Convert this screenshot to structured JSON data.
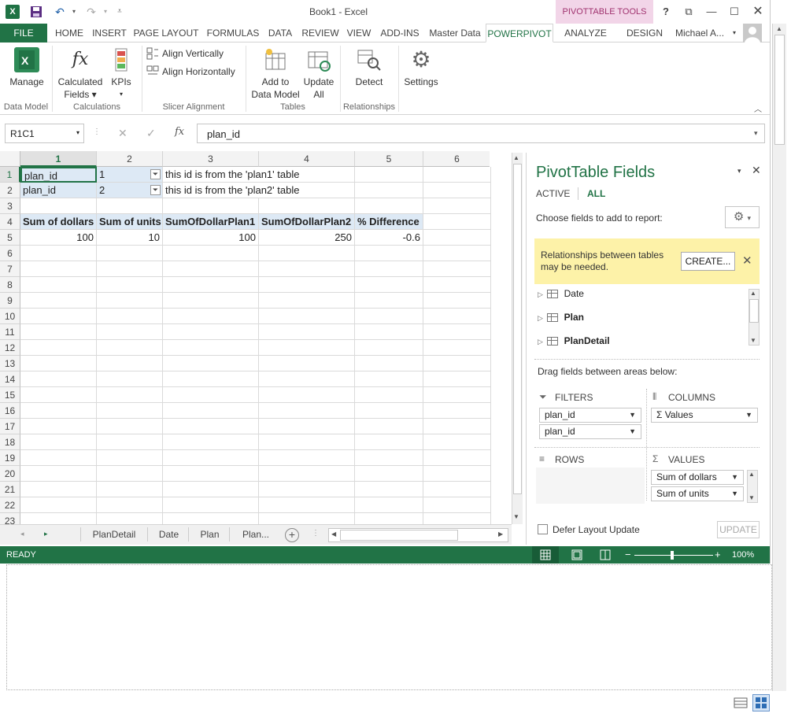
{
  "titlebar": {
    "title": "Book1 - Excel",
    "pivot_tools": "PIVOTTABLE TOOLS",
    "help": "?"
  },
  "tabs": {
    "file": "FILE",
    "items": [
      "HOME",
      "INSERT",
      "PAGE LAYOUT",
      "FORMULAS",
      "DATA",
      "REVIEW",
      "VIEW",
      "ADD-INS",
      "Master Data",
      "POWERPIVOT",
      "ANALYZE",
      "DESIGN"
    ],
    "user": "Michael A..."
  },
  "ribbon": {
    "manage": "Manage",
    "calculated_fields": "Calculated",
    "calculated_fields_2": "Fields",
    "kpis": "KPIs",
    "align_vertically": "Align Vertically",
    "align_horizontally": "Align Horizontally",
    "add_to_data_model": "Add to",
    "add_to_data_model_2": "Data Model",
    "update_all": "Update",
    "update_all_2": "All",
    "detect": "Detect",
    "settings": "Settings",
    "groups": {
      "data_model": "Data Model",
      "calculations": "Calculations",
      "slicer_alignment": "Slicer Alignment",
      "tables": "Tables",
      "relationships": "Relationships"
    }
  },
  "formula_bar": {
    "name_box": "R1C1",
    "fx": "fx",
    "formula": "plan_id"
  },
  "grid": {
    "columns": [
      "1",
      "2",
      "3",
      "4",
      "5",
      "6"
    ],
    "rows": [
      "1",
      "2",
      "3",
      "4",
      "5",
      "6",
      "7",
      "8",
      "9",
      "10",
      "11",
      "12",
      "13",
      "14",
      "15",
      "16",
      "17",
      "18",
      "19",
      "20",
      "21",
      "22",
      "23"
    ],
    "r1": {
      "a": "plan_id",
      "b": "1",
      "c": "this id is from the 'plan1' table"
    },
    "r2": {
      "a": "plan_id",
      "b": "2",
      "c": "this id is from the 'plan2' table"
    },
    "headers": [
      "Sum of dollars",
      "Sum of units",
      "SumOfDollarPlan1",
      "SumOfDollarPlan2",
      "% Difference"
    ],
    "values": [
      "100",
      "10",
      "100",
      "250",
      "-0.6"
    ]
  },
  "sheets": {
    "tabs": [
      "PlanDetail",
      "Date",
      "Plan",
      "Plan..."
    ],
    "more": "..."
  },
  "status": {
    "ready": "READY",
    "zoom": "100%"
  },
  "pivot_pane": {
    "title": "PivotTable Fields",
    "tab_active": "ACTIVE",
    "tab_all": "ALL",
    "choose": "Choose fields to add to report:",
    "warning": "Relationships between tables may be needed.",
    "create": "CREATE...",
    "fields": [
      "Date",
      "Plan",
      "PlanDetail"
    ],
    "drag": "Drag fields between areas below:",
    "filters_label": "FILTERS",
    "columns_label": "COLUMNS",
    "rows_label": "ROWS",
    "values_label": "VALUES",
    "filters": [
      "plan_id",
      "plan_id"
    ],
    "columns": [
      "Values"
    ],
    "values": [
      "Sum of dollars",
      "Sum of units"
    ],
    "defer": "Defer Layout Update",
    "update": "UPDATE"
  }
}
